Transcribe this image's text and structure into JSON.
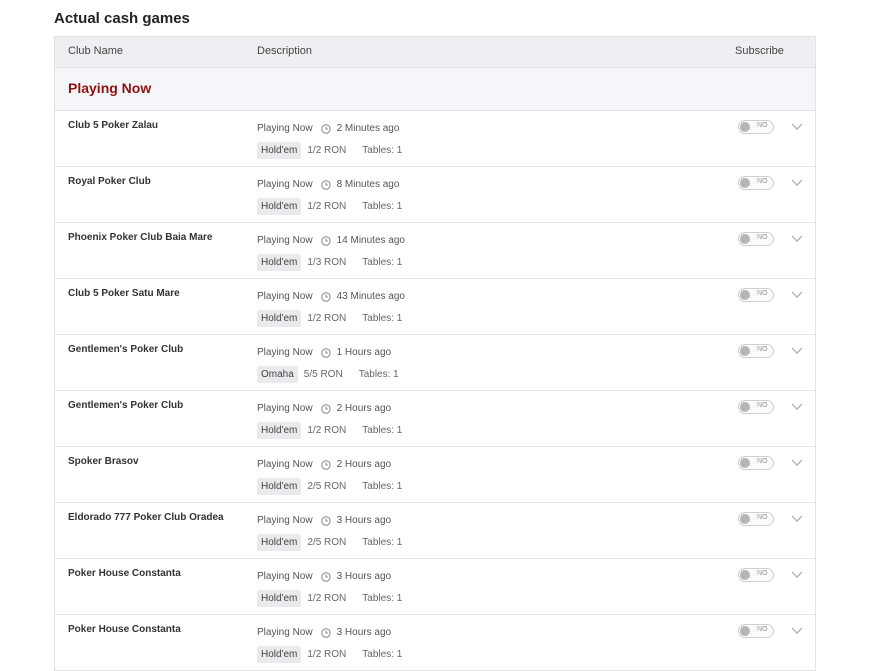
{
  "page": {
    "title": "Actual cash games"
  },
  "table": {
    "headers": {
      "club": "Club Name",
      "description": "Description",
      "subscribe": "Subscribe"
    },
    "section_title": "Playing Now",
    "toggle_label": "NO",
    "rows": [
      {
        "club": "Club 5 Poker Zalau",
        "status": "Playing Now",
        "time": "2 Minutes ago",
        "game": "Hold'em",
        "stakes": "1/2 RON",
        "tables": "Tables: 1"
      },
      {
        "club": "Royal Poker Club",
        "status": "Playing Now",
        "time": "8 Minutes ago",
        "game": "Hold'em",
        "stakes": "1/2 RON",
        "tables": "Tables: 1"
      },
      {
        "club": "Phoenix Poker Club Baia Mare",
        "status": "Playing Now",
        "time": "14 Minutes ago",
        "game": "Hold'em",
        "stakes": "1/3 RON",
        "tables": "Tables: 1"
      },
      {
        "club": "Club 5 Poker Satu Mare",
        "status": "Playing Now",
        "time": "43 Minutes ago",
        "game": "Hold'em",
        "stakes": "1/2 RON",
        "tables": "Tables: 1"
      },
      {
        "club": "Gentlemen's Poker Club",
        "status": "Playing Now",
        "time": "1 Hours ago",
        "game": "Omaha",
        "stakes": "5/5 RON",
        "tables": "Tables: 1"
      },
      {
        "club": "Gentlemen's Poker Club",
        "status": "Playing Now",
        "time": "2 Hours ago",
        "game": "Hold'em",
        "stakes": "1/2 RON",
        "tables": "Tables: 1"
      },
      {
        "club": "Spoker Brasov",
        "status": "Playing Now",
        "time": "2 Hours ago",
        "game": "Hold'em",
        "stakes": "2/5 RON",
        "tables": "Tables: 1"
      },
      {
        "club": "Eldorado 777 Poker Club Oradea",
        "status": "Playing Now",
        "time": "3 Hours ago",
        "game": "Hold'em",
        "stakes": "2/5 RON",
        "tables": "Tables: 1"
      },
      {
        "club": "Poker House Constanta",
        "status": "Playing Now",
        "time": "3 Hours ago",
        "game": "Hold'em",
        "stakes": "1/2 RON",
        "tables": "Tables: 1"
      },
      {
        "club": "Poker House Constanta",
        "status": "Playing Now",
        "time": "3 Hours ago",
        "game": "Hold'em",
        "stakes": "1/2 RON",
        "tables": "Tables: 1"
      }
    ]
  },
  "icons": {
    "time": "clock-icon",
    "expand": "chevron-down-icon"
  },
  "colors": {
    "section_title": "#8b1212",
    "header_bg": "#eeeff3",
    "badge_bg": "#e9eaee"
  }
}
